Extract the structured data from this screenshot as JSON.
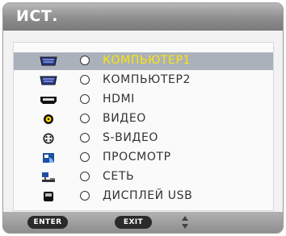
{
  "title": "ИСТ.",
  "sources": [
    {
      "icon": "computer-connector-icon",
      "label": "КОМПЬЮТЕР1",
      "selected": true
    },
    {
      "icon": "computer-connector-icon",
      "label": "КОМПЬЮТЕР2",
      "selected": false
    },
    {
      "icon": "hdmi-connector-icon",
      "label": "HDMI",
      "selected": false
    },
    {
      "icon": "rca-video-icon",
      "label": "ВИДЕО",
      "selected": false
    },
    {
      "icon": "s-video-icon",
      "label": "S-ВИДЕО",
      "selected": false
    },
    {
      "icon": "viewer-icon",
      "label": "ПРОСМОТР",
      "selected": false
    },
    {
      "icon": "network-icon",
      "label": "СЕТЬ",
      "selected": false
    },
    {
      "icon": "usb-display-icon",
      "label": "ДИСПЛЕЙ USB",
      "selected": false
    }
  ],
  "footer": {
    "enter_label": "ENTER",
    "exit_label": "EXIT",
    "nav_icon": "up-down-arrows-icon"
  },
  "colors": {
    "selected_text": "#ffe600",
    "selected_row": "#aab1bb"
  }
}
